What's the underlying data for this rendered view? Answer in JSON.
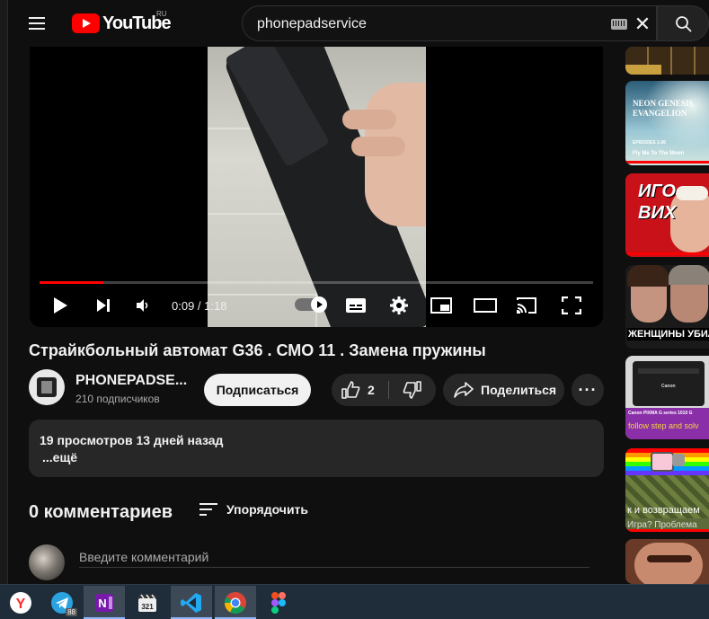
{
  "header": {
    "logo_text": "YouTube",
    "logo_country": "RU",
    "search_value": "phonepadservice"
  },
  "player": {
    "time_display": "0:09 / 1:18",
    "progress_fraction": 0.115
  },
  "video": {
    "title": "Страйкбольный автомат G36 . СМО 11 . Замена пружины",
    "channel_name": "PHONEPADSE...",
    "subscribers": "210 подписчиков",
    "subscribe_label": "Подписаться",
    "like_count": "2",
    "share_label": "Поделиться",
    "more_label": "···"
  },
  "description": {
    "meta": "19 просмотров  13 дней назад",
    "more": "...ещё"
  },
  "comments": {
    "count_label": "0 комментариев",
    "sort_label": "Упорядочить",
    "input_placeholder": "Введите комментарий"
  },
  "sidebar": {
    "thumb_2_title": "NEON GENESIS EVANGELION",
    "thumb_2_sub": "EPISODES 1-26",
    "thumb_2_caption": "Fly Me To The Moon",
    "thumb_3_text": "ИГО ВИХ",
    "thumb_4_text": "ЖЕНЩИНЫ УБИЛИ",
    "thumb_5_brand": "Canon",
    "thumb_5_caption": "Canon PIXMA G series 1010 G",
    "thumb_5_caption2": "follow step and solv",
    "thumb_6_text": "к и возвращаем",
    "thumb_6_text2": "Игра? Проблема"
  },
  "taskbar": {
    "telegram_badge": "88"
  },
  "colors": {
    "accent_red": "#ff0000",
    "background": "#0f0f0f",
    "surface": "#272727"
  }
}
